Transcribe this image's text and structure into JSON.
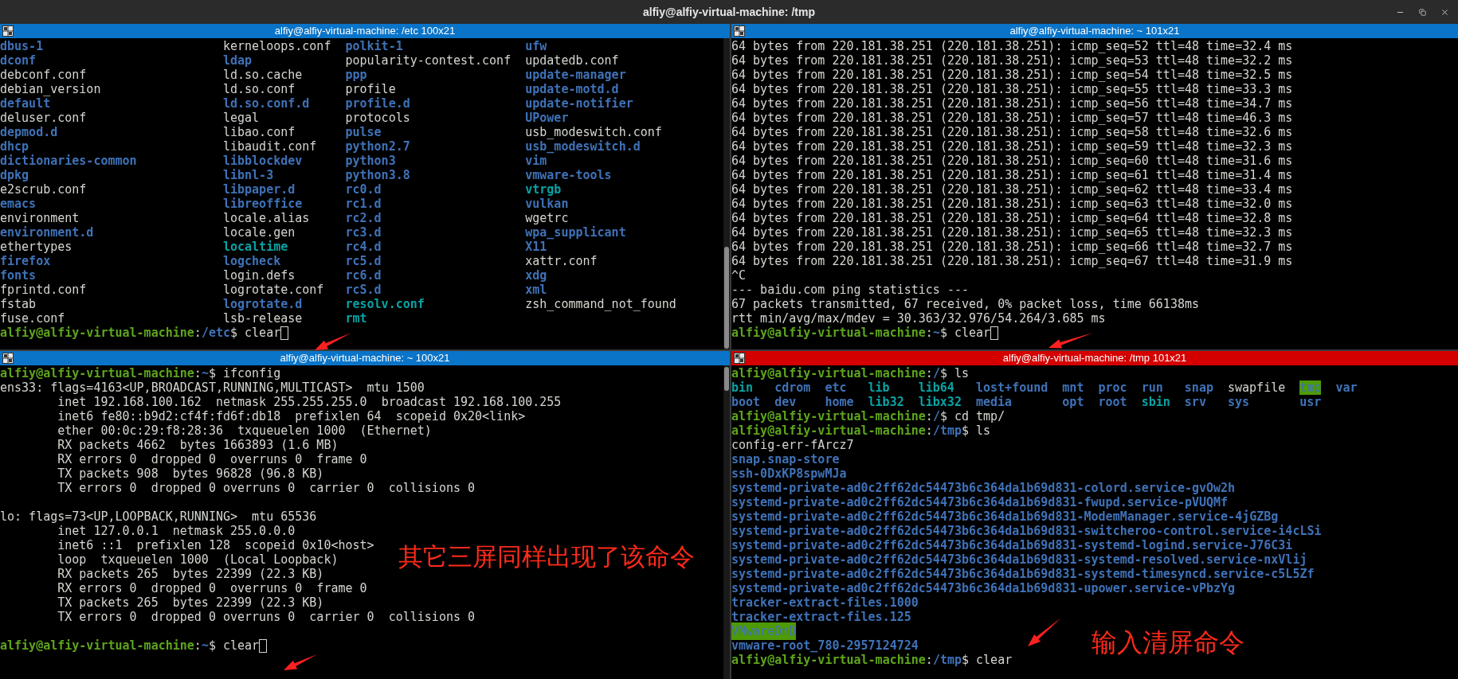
{
  "window": {
    "title": "alfiy@alfiy-virtual-machine: /tmp"
  },
  "panes": [
    {
      "title": "alfiy@alfiy-virtual-machine: /etc 100x21",
      "focused": false,
      "lines": [
        {
          "kind": "ls_row",
          "cells": [
            {
              "text": "dbus-1",
              "kind": "dir"
            },
            {
              "text": "kerneloops.conf",
              "kind": "file"
            },
            {
              "text": "polkit-1",
              "kind": "dir"
            },
            {
              "text": "ufw",
              "kind": "dir"
            }
          ]
        },
        {
          "kind": "ls_row",
          "cells": [
            {
              "text": "dconf",
              "kind": "dir"
            },
            {
              "text": "ldap",
              "kind": "dir"
            },
            {
              "text": "popularity-contest.conf",
              "kind": "file"
            },
            {
              "text": "updatedb.conf",
              "kind": "file"
            }
          ]
        },
        {
          "kind": "ls_row",
          "cells": [
            {
              "text": "debconf.conf",
              "kind": "file"
            },
            {
              "text": "ld.so.cache",
              "kind": "file"
            },
            {
              "text": "ppp",
              "kind": "dir"
            },
            {
              "text": "update-manager",
              "kind": "dir"
            }
          ]
        },
        {
          "kind": "ls_row",
          "cells": [
            {
              "text": "debian_version",
              "kind": "file"
            },
            {
              "text": "ld.so.conf",
              "kind": "file"
            },
            {
              "text": "profile",
              "kind": "file"
            },
            {
              "text": "update-motd.d",
              "kind": "dir"
            }
          ]
        },
        {
          "kind": "ls_row",
          "cells": [
            {
              "text": "default",
              "kind": "dir"
            },
            {
              "text": "ld.so.conf.d",
              "kind": "dir"
            },
            {
              "text": "profile.d",
              "kind": "dir"
            },
            {
              "text": "update-notifier",
              "kind": "dir"
            }
          ]
        },
        {
          "kind": "ls_row",
          "cells": [
            {
              "text": "deluser.conf",
              "kind": "file"
            },
            {
              "text": "legal",
              "kind": "file"
            },
            {
              "text": "protocols",
              "kind": "file"
            },
            {
              "text": "UPower",
              "kind": "dir"
            }
          ]
        },
        {
          "kind": "ls_row",
          "cells": [
            {
              "text": "depmod.d",
              "kind": "dir"
            },
            {
              "text": "libao.conf",
              "kind": "file"
            },
            {
              "text": "pulse",
              "kind": "dir"
            },
            {
              "text": "usb_modeswitch.conf",
              "kind": "file"
            }
          ]
        },
        {
          "kind": "ls_row",
          "cells": [
            {
              "text": "dhcp",
              "kind": "dir"
            },
            {
              "text": "libaudit.conf",
              "kind": "file"
            },
            {
              "text": "python2.7",
              "kind": "dir"
            },
            {
              "text": "usb_modeswitch.d",
              "kind": "dir"
            }
          ]
        },
        {
          "kind": "ls_row",
          "cells": [
            {
              "text": "dictionaries-common",
              "kind": "dir"
            },
            {
              "text": "libblockdev",
              "kind": "dir"
            },
            {
              "text": "python3",
              "kind": "dir"
            },
            {
              "text": "vim",
              "kind": "dir"
            }
          ]
        },
        {
          "kind": "ls_row",
          "cells": [
            {
              "text": "dpkg",
              "kind": "dir"
            },
            {
              "text": "libnl-3",
              "kind": "dir"
            },
            {
              "text": "python3.8",
              "kind": "dir"
            },
            {
              "text": "vmware-tools",
              "kind": "dir"
            }
          ]
        },
        {
          "kind": "ls_row",
          "cells": [
            {
              "text": "e2scrub.conf",
              "kind": "file"
            },
            {
              "text": "libpaper.d",
              "kind": "dir"
            },
            {
              "text": "rc0.d",
              "kind": "dir"
            },
            {
              "text": "vtrgb",
              "kind": "link"
            }
          ]
        },
        {
          "kind": "ls_row",
          "cells": [
            {
              "text": "emacs",
              "kind": "dir"
            },
            {
              "text": "libreoffice",
              "kind": "dir"
            },
            {
              "text": "rc1.d",
              "kind": "dir"
            },
            {
              "text": "vulkan",
              "kind": "dir"
            }
          ]
        },
        {
          "kind": "ls_row",
          "cells": [
            {
              "text": "environment",
              "kind": "file"
            },
            {
              "text": "locale.alias",
              "kind": "file"
            },
            {
              "text": "rc2.d",
              "kind": "dir"
            },
            {
              "text": "wgetrc",
              "kind": "file"
            }
          ]
        },
        {
          "kind": "ls_row",
          "cells": [
            {
              "text": "environment.d",
              "kind": "dir"
            },
            {
              "text": "locale.gen",
              "kind": "file"
            },
            {
              "text": "rc3.d",
              "kind": "dir"
            },
            {
              "text": "wpa_supplicant",
              "kind": "dir"
            }
          ]
        },
        {
          "kind": "ls_row",
          "cells": [
            {
              "text": "ethertypes",
              "kind": "file"
            },
            {
              "text": "localtime",
              "kind": "link"
            },
            {
              "text": "rc4.d",
              "kind": "dir"
            },
            {
              "text": "X11",
              "kind": "dir"
            }
          ]
        },
        {
          "kind": "ls_row",
          "cells": [
            {
              "text": "firefox",
              "kind": "dir"
            },
            {
              "text": "logcheck",
              "kind": "dir"
            },
            {
              "text": "rc5.d",
              "kind": "dir"
            },
            {
              "text": "xattr.conf",
              "kind": "file"
            }
          ]
        },
        {
          "kind": "ls_row",
          "cells": [
            {
              "text": "fonts",
              "kind": "dir"
            },
            {
              "text": "login.defs",
              "kind": "file"
            },
            {
              "text": "rc6.d",
              "kind": "dir"
            },
            {
              "text": "xdg",
              "kind": "dir"
            }
          ]
        },
        {
          "kind": "ls_row",
          "cells": [
            {
              "text": "fprintd.conf",
              "kind": "file"
            },
            {
              "text": "logrotate.conf",
              "kind": "file"
            },
            {
              "text": "rcS.d",
              "kind": "dir"
            },
            {
              "text": "xml",
              "kind": "dir"
            }
          ]
        },
        {
          "kind": "ls_row",
          "cells": [
            {
              "text": "fstab",
              "kind": "file"
            },
            {
              "text": "logrotate.d",
              "kind": "dir"
            },
            {
              "text": "resolv.conf",
              "kind": "link"
            },
            {
              "text": "zsh_command_not_found",
              "kind": "file"
            }
          ]
        },
        {
          "kind": "ls_row",
          "cells": [
            {
              "text": "fuse.conf",
              "kind": "file"
            },
            {
              "text": "lsb-release",
              "kind": "file"
            },
            {
              "text": "rmt",
              "kind": "link"
            }
          ]
        },
        {
          "kind": "prompt",
          "user": "alfiy@alfiy-virtual-machine",
          "separator": ":",
          "path": "/etc",
          "symbol": "$",
          "command": "clear",
          "cursor": true
        }
      ]
    },
    {
      "title": "alfiy@alfiy-virtual-machine: ~ 101x21",
      "focused": false,
      "lines": [
        {
          "kind": "text",
          "text": "64 bytes from 220.181.38.251 (220.181.38.251): icmp_seq=52 ttl=48 time=32.4 ms"
        },
        {
          "kind": "text",
          "text": "64 bytes from 220.181.38.251 (220.181.38.251): icmp_seq=53 ttl=48 time=32.2 ms"
        },
        {
          "kind": "text",
          "text": "64 bytes from 220.181.38.251 (220.181.38.251): icmp_seq=54 ttl=48 time=32.5 ms"
        },
        {
          "kind": "text",
          "text": "64 bytes from 220.181.38.251 (220.181.38.251): icmp_seq=55 ttl=48 time=33.3 ms"
        },
        {
          "kind": "text",
          "text": "64 bytes from 220.181.38.251 (220.181.38.251): icmp_seq=56 ttl=48 time=34.7 ms"
        },
        {
          "kind": "text",
          "text": "64 bytes from 220.181.38.251 (220.181.38.251): icmp_seq=57 ttl=48 time=46.3 ms"
        },
        {
          "kind": "text",
          "text": "64 bytes from 220.181.38.251 (220.181.38.251): icmp_seq=58 ttl=48 time=32.6 ms"
        },
        {
          "kind": "text",
          "text": "64 bytes from 220.181.38.251 (220.181.38.251): icmp_seq=59 ttl=48 time=32.3 ms"
        },
        {
          "kind": "text",
          "text": "64 bytes from 220.181.38.251 (220.181.38.251): icmp_seq=60 ttl=48 time=31.6 ms"
        },
        {
          "kind": "text",
          "text": "64 bytes from 220.181.38.251 (220.181.38.251): icmp_seq=61 ttl=48 time=31.4 ms"
        },
        {
          "kind": "text",
          "text": "64 bytes from 220.181.38.251 (220.181.38.251): icmp_seq=62 ttl=48 time=33.4 ms"
        },
        {
          "kind": "text",
          "text": "64 bytes from 220.181.38.251 (220.181.38.251): icmp_seq=63 ttl=48 time=32.0 ms"
        },
        {
          "kind": "text",
          "text": "64 bytes from 220.181.38.251 (220.181.38.251): icmp_seq=64 ttl=48 time=32.8 ms"
        },
        {
          "kind": "text",
          "text": "64 bytes from 220.181.38.251 (220.181.38.251): icmp_seq=65 ttl=48 time=32.3 ms"
        },
        {
          "kind": "text",
          "text": "64 bytes from 220.181.38.251 (220.181.38.251): icmp_seq=66 ttl=48 time=32.7 ms"
        },
        {
          "kind": "text",
          "text": "64 bytes from 220.181.38.251 (220.181.38.251): icmp_seq=67 ttl=48 time=31.9 ms"
        },
        {
          "kind": "text",
          "text": "^C"
        },
        {
          "kind": "text",
          "text": "--- baidu.com ping statistics ---"
        },
        {
          "kind": "text",
          "text": "67 packets transmitted, 67 received, 0% packet loss, time 66138ms"
        },
        {
          "kind": "text",
          "text": "rtt min/avg/max/mdev = 30.363/32.976/54.264/3.685 ms"
        },
        {
          "kind": "prompt",
          "user": "alfiy@alfiy-virtual-machine",
          "separator": ":",
          "path": "~",
          "symbol": "$",
          "command": "clear",
          "cursor": true
        }
      ]
    },
    {
      "title": "alfiy@alfiy-virtual-machine: ~ 100x21",
      "focused": false,
      "annotation": "其它三屏同样出现了该命令",
      "lines": [
        {
          "kind": "prompt",
          "user": "alfiy@alfiy-virtual-machine",
          "separator": ":",
          "path": "~",
          "symbol": "$",
          "command": "ifconfig",
          "cursor": false
        },
        {
          "kind": "text",
          "text": "ens33: flags=4163<UP,BROADCAST,RUNNING,MULTICAST>  mtu 1500"
        },
        {
          "kind": "text",
          "text": "        inet 192.168.100.162  netmask 255.255.255.0  broadcast 192.168.100.255"
        },
        {
          "kind": "text",
          "text": "        inet6 fe80::b9d2:cf4f:fd6f:db18  prefixlen 64  scopeid 0x20<link>"
        },
        {
          "kind": "text",
          "text": "        ether 00:0c:29:f8:28:36  txqueuelen 1000  (Ethernet)"
        },
        {
          "kind": "text",
          "text": "        RX packets 4662  bytes 1663893 (1.6 MB)"
        },
        {
          "kind": "text",
          "text": "        RX errors 0  dropped 0  overruns 0  frame 0"
        },
        {
          "kind": "text",
          "text": "        TX packets 908  bytes 96828 (96.8 KB)"
        },
        {
          "kind": "text",
          "text": "        TX errors 0  dropped 0 overruns 0  carrier 0  collisions 0"
        },
        {
          "kind": "blank"
        },
        {
          "kind": "text",
          "text": "lo: flags=73<UP,LOOPBACK,RUNNING>  mtu 65536"
        },
        {
          "kind": "text",
          "text": "        inet 127.0.0.1  netmask 255.0.0.0"
        },
        {
          "kind": "text",
          "text": "        inet6 ::1  prefixlen 128  scopeid 0x10<host>"
        },
        {
          "kind": "text",
          "text": "        loop  txqueuelen 1000  (Local Loopback)"
        },
        {
          "kind": "text",
          "text": "        RX packets 265  bytes 22399 (22.3 KB)"
        },
        {
          "kind": "text",
          "text": "        RX errors 0  dropped 0  overruns 0  frame 0"
        },
        {
          "kind": "text",
          "text": "        TX packets 265  bytes 22399 (22.3 KB)"
        },
        {
          "kind": "text",
          "text": "        TX errors 0  dropped 0 overruns 0  carrier 0  collisions 0"
        },
        {
          "kind": "blank"
        },
        {
          "kind": "prompt",
          "user": "alfiy@alfiy-virtual-machine",
          "separator": ":",
          "path": "~",
          "symbol": "$",
          "command": "clear",
          "cursor": true
        }
      ]
    },
    {
      "title": "alfiy@alfiy-virtual-machine: /tmp 101x21",
      "focused": true,
      "annotation": "输入清屏命令",
      "lines": [
        {
          "kind": "prompt",
          "user": "alfiy@alfiy-virtual-machine",
          "separator": ":",
          "path": "/",
          "symbol": "$",
          "command": "ls",
          "cursor": false
        },
        {
          "kind": "ls_row",
          "cells": [
            {
              "text": "bin",
              "kind": "link"
            },
            {
              "text": "cdrom",
              "kind": "dir"
            },
            {
              "text": "etc",
              "kind": "dir"
            },
            {
              "text": "lib",
              "kind": "link"
            },
            {
              "text": "lib64",
              "kind": "link"
            },
            {
              "text": "lost+found",
              "kind": "dir"
            },
            {
              "text": "mnt",
              "kind": "dir"
            },
            {
              "text": "proc",
              "kind": "dir"
            },
            {
              "text": "run",
              "kind": "dir"
            },
            {
              "text": "snap",
              "kind": "dir"
            },
            {
              "text": "swapfile",
              "kind": "file"
            },
            {
              "text": "tmp",
              "kind": "highlight"
            },
            {
              "text": "var",
              "kind": "dir"
            }
          ]
        },
        {
          "kind": "ls_row",
          "cells": [
            {
              "text": "boot",
              "kind": "dir"
            },
            {
              "text": "dev",
              "kind": "dir"
            },
            {
              "text": "home",
              "kind": "dir"
            },
            {
              "text": "lib32",
              "kind": "link"
            },
            {
              "text": "libx32",
              "kind": "link"
            },
            {
              "text": "media",
              "kind": "dir"
            },
            {
              "text": "opt",
              "kind": "dir"
            },
            {
              "text": "root",
              "kind": "dir"
            },
            {
              "text": "sbin",
              "kind": "link"
            },
            {
              "text": "srv",
              "kind": "dir"
            },
            {
              "text": "sys",
              "kind": "dir"
            },
            {
              "text": "usr",
              "kind": "dir"
            }
          ]
        },
        {
          "kind": "prompt",
          "user": "alfiy@alfiy-virtual-machine",
          "separator": ":",
          "path": "/",
          "symbol": "$",
          "command": "cd tmp/",
          "cursor": false
        },
        {
          "kind": "prompt",
          "user": "alfiy@alfiy-virtual-machine",
          "separator": ":",
          "path": "/tmp",
          "symbol": "$",
          "command": "ls",
          "cursor": false
        },
        {
          "kind": "file",
          "text": "config-err-fArcz7"
        },
        {
          "kind": "dir",
          "text": "snap.snap-store"
        },
        {
          "kind": "dir",
          "text": "ssh-0DxKP8spwMJa"
        },
        {
          "kind": "dir",
          "text": "systemd-private-ad0c2ff62dc54473b6c364da1b69d831-colord.service-gvOw2h"
        },
        {
          "kind": "dir",
          "text": "systemd-private-ad0c2ff62dc54473b6c364da1b69d831-fwupd.service-pVUQMf"
        },
        {
          "kind": "dir",
          "text": "systemd-private-ad0c2ff62dc54473b6c364da1b69d831-ModemManager.service-4jGZBg"
        },
        {
          "kind": "dir",
          "text": "systemd-private-ad0c2ff62dc54473b6c364da1b69d831-switcheroo-control.service-i4cLSi"
        },
        {
          "kind": "dir",
          "text": "systemd-private-ad0c2ff62dc54473b6c364da1b69d831-systemd-logind.service-J76C3i"
        },
        {
          "kind": "dir",
          "text": "systemd-private-ad0c2ff62dc54473b6c364da1b69d831-systemd-resolved.service-nxVlij"
        },
        {
          "kind": "dir",
          "text": "systemd-private-ad0c2ff62dc54473b6c364da1b69d831-systemd-timesyncd.service-c5L5Zf"
        },
        {
          "kind": "dir",
          "text": "systemd-private-ad0c2ff62dc54473b6c364da1b69d831-upower.service-vPbzYg"
        },
        {
          "kind": "dir",
          "text": "tracker-extract-files.1000"
        },
        {
          "kind": "dir",
          "text": "tracker-extract-files.125"
        },
        {
          "kind": "highlight",
          "text": "VMwareDnD"
        },
        {
          "kind": "dir",
          "text": "vmware-root_780-2957124724"
        },
        {
          "kind": "prompt",
          "user": "alfiy@alfiy-virtual-machine",
          "separator": ":",
          "path": "/tmp",
          "symbol": "$",
          "command": "clear",
          "cursor": false
        }
      ]
    }
  ]
}
